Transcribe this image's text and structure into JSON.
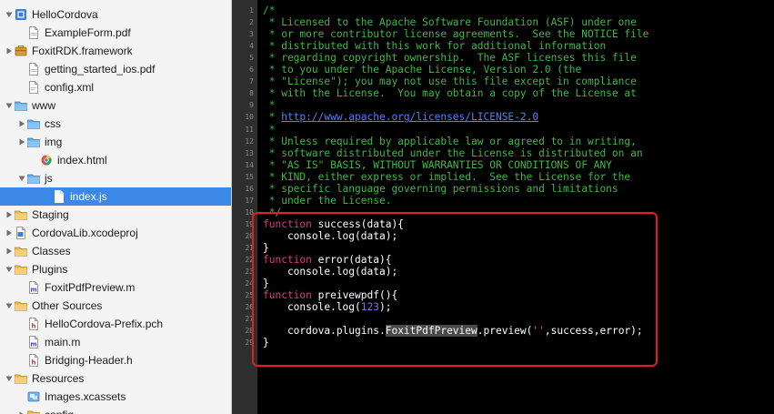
{
  "navigator": {
    "items": [
      {
        "label": "HelloCordova",
        "icon": "project-icon",
        "disclosure": "open"
      },
      {
        "label": "ExampleForm.pdf",
        "icon": "pdf-file-icon",
        "disclosure": "none"
      },
      {
        "label": "FoxitRDK.framework",
        "icon": "framework-icon",
        "disclosure": "closed"
      },
      {
        "label": "getting_started_ios.pdf",
        "icon": "pdf-file-icon",
        "disclosure": "none"
      },
      {
        "label": "config.xml",
        "icon": "xml-file-icon",
        "disclosure": "none"
      },
      {
        "label": "www",
        "icon": "blue-folder-icon",
        "disclosure": "open"
      },
      {
        "label": "css",
        "icon": "blue-folder-icon",
        "disclosure": "closed"
      },
      {
        "label": "img",
        "icon": "blue-folder-icon",
        "disclosure": "closed"
      },
      {
        "label": "index.html",
        "icon": "html-file-icon",
        "disclosure": "none"
      },
      {
        "label": "js",
        "icon": "blue-folder-icon",
        "disclosure": "open"
      },
      {
        "label": "index.js",
        "icon": "js-file-icon",
        "disclosure": "none",
        "selected": true
      },
      {
        "label": "Staging",
        "icon": "yellow-folder-icon",
        "disclosure": "closed"
      },
      {
        "label": "CordovaLib.xcodeproj",
        "icon": "xcodeproj-icon",
        "disclosure": "closed"
      },
      {
        "label": "Classes",
        "icon": "yellow-folder-icon",
        "disclosure": "closed"
      },
      {
        "label": "Plugins",
        "icon": "yellow-folder-icon",
        "disclosure": "open"
      },
      {
        "label": "FoxitPdfPreview.m",
        "icon": "objc-file-icon",
        "disclosure": "none"
      },
      {
        "label": "Other Sources",
        "icon": "yellow-folder-icon",
        "disclosure": "open"
      },
      {
        "label": "HelloCordova-Prefix.pch",
        "icon": "header-file-icon",
        "disclosure": "none"
      },
      {
        "label": "main.m",
        "icon": "objc-file-icon",
        "disclosure": "none"
      },
      {
        "label": "Bridging-Header.h",
        "icon": "header-file-icon",
        "disclosure": "none"
      },
      {
        "label": "Resources",
        "icon": "yellow-folder-icon",
        "disclosure": "open"
      },
      {
        "label": "Images.xcassets",
        "icon": "assets-folder-icon",
        "disclosure": "none"
      },
      {
        "label": "config",
        "icon": "yellow-folder-icon",
        "disclosure": "closed"
      }
    ]
  },
  "editor": {
    "lines": [
      {
        "num": "1",
        "tokens": [
          {
            "t": "/*",
            "c": "c"
          }
        ]
      },
      {
        "num": "2",
        "tokens": [
          {
            "t": " * Licensed to the Apache Software Foundation (ASF) under one",
            "c": "c"
          }
        ]
      },
      {
        "num": "3",
        "tokens": [
          {
            "t": " * or more contributor license agreements.  See the NOTICE file",
            "c": "c"
          }
        ]
      },
      {
        "num": "4",
        "tokens": [
          {
            "t": " * distributed with this work for additional information",
            "c": "c"
          }
        ]
      },
      {
        "num": "5",
        "tokens": [
          {
            "t": " * regarding copyright ownership.  The ASF licenses this file",
            "c": "c"
          }
        ]
      },
      {
        "num": "6",
        "tokens": [
          {
            "t": " * to you under the Apache License, Version 2.0 (the",
            "c": "c"
          }
        ]
      },
      {
        "num": "7",
        "tokens": [
          {
            "t": " * \"License\"); you may not use this file except in compliance",
            "c": "c"
          }
        ]
      },
      {
        "num": "8",
        "tokens": [
          {
            "t": " * with the License.  You may obtain a copy of the License at",
            "c": "c"
          }
        ]
      },
      {
        "num": "9",
        "tokens": [
          {
            "t": " *",
            "c": "c"
          }
        ]
      },
      {
        "num": "10",
        "tokens": [
          {
            "t": " * ",
            "c": "c"
          },
          {
            "t": "http://www.apache.org/licenses/LICENSE-2.0",
            "c": "u"
          }
        ]
      },
      {
        "num": "11",
        "tokens": [
          {
            "t": " *",
            "c": "c"
          }
        ]
      },
      {
        "num": "12",
        "tokens": [
          {
            "t": " * Unless required by applicable law or agreed to in writing,",
            "c": "c"
          }
        ]
      },
      {
        "num": "13",
        "tokens": [
          {
            "t": " * software distributed under the License is distributed on an",
            "c": "c"
          }
        ]
      },
      {
        "num": "14",
        "tokens": [
          {
            "t": " * \"AS IS\" BASIS, WITHOUT WARRANTIES OR CONDITIONS OF ANY",
            "c": "c"
          }
        ]
      },
      {
        "num": "15",
        "tokens": [
          {
            "t": " * KIND, either express or implied.  See the License for the",
            "c": "c"
          }
        ]
      },
      {
        "num": "16",
        "tokens": [
          {
            "t": " * specific language governing permissions and limitations",
            "c": "c"
          }
        ]
      },
      {
        "num": "17",
        "tokens": [
          {
            "t": " * under the License.",
            "c": "c"
          }
        ]
      },
      {
        "num": "18",
        "tokens": [
          {
            "t": " */",
            "c": "c"
          }
        ]
      },
      {
        "num": "19",
        "tokens": [
          {
            "t": "function",
            "c": "kw"
          },
          {
            "t": " success(data){",
            "c": ""
          }
        ]
      },
      {
        "num": "20",
        "tokens": [
          {
            "t": "    console.log(data);",
            "c": ""
          }
        ]
      },
      {
        "num": "21",
        "tokens": [
          {
            "t": "}",
            "c": ""
          }
        ]
      },
      {
        "num": "22",
        "tokens": [
          {
            "t": "function",
            "c": "kw"
          },
          {
            "t": " error(data){",
            "c": ""
          }
        ]
      },
      {
        "num": "23",
        "tokens": [
          {
            "t": "    console.log(data);",
            "c": ""
          }
        ]
      },
      {
        "num": "24",
        "tokens": [
          {
            "t": "}",
            "c": ""
          }
        ]
      },
      {
        "num": "25",
        "tokens": [
          {
            "t": "function",
            "c": "kw"
          },
          {
            "t": " preivewpdf(){",
            "c": ""
          }
        ]
      },
      {
        "num": "26",
        "tokens": [
          {
            "t": "    console.log(",
            "c": ""
          },
          {
            "t": "123",
            "c": "num"
          },
          {
            "t": ");",
            "c": ""
          }
        ]
      },
      {
        "num": "27",
        "tokens": [
          {
            "t": "",
            "c": ""
          }
        ]
      },
      {
        "num": "28",
        "tokens": [
          {
            "t": "    cordova.plugins.",
            "c": ""
          },
          {
            "t": "FoxitPdfPreview",
            "c": "hl"
          },
          {
            "t": ".preview(",
            "c": ""
          },
          {
            "t": "''",
            "c": "str"
          },
          {
            "t": ",success,error);",
            "c": ""
          }
        ]
      },
      {
        "num": "29",
        "tokens": [
          {
            "t": "}",
            "c": ""
          }
        ]
      }
    ]
  },
  "colors": {
    "selection": "#3b88e6",
    "comment": "#41b645",
    "keyword": "#d23f86",
    "highlight_box": "#e02020"
  }
}
